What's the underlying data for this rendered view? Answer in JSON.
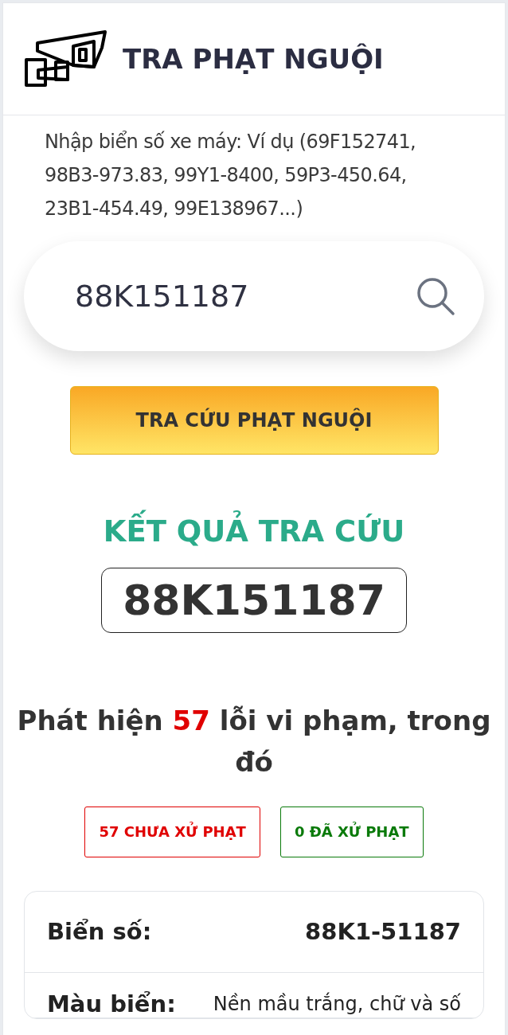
{
  "header": {
    "title": "TRA PHẠT NGUỘI"
  },
  "instructions": "Nhập biển số xe máy: Ví dụ (69F152741, 98B3-973.83, 99Y1-8400, 59P3-450.64, 23B1-454.49, 99E138967...)",
  "search": {
    "value": "88K151187"
  },
  "submit_button": "TRA CỨU PHẠT NGUỘI",
  "result": {
    "heading": "KẾT QUẢ TRA CỨU",
    "plate": "88K151187",
    "summary": {
      "before": "Phát hiện",
      "count": "57",
      "after": "lỗi vi phạm, trong đó"
    }
  },
  "status_badges": [
    {
      "text": "57 CHƯA XỬ PHẠT",
      "color": "#e00000"
    },
    {
      "text": "0 ĐÃ XỬ PHẠT",
      "color": "#0a7a0a"
    }
  ],
  "details": [
    {
      "label": "Biển số:",
      "value": "88K1-51187",
      "kind": "bold"
    },
    {
      "label": "Màu biển:",
      "value": "Nền mầu trắng, chữ và số",
      "kind": "plain"
    }
  ]
}
